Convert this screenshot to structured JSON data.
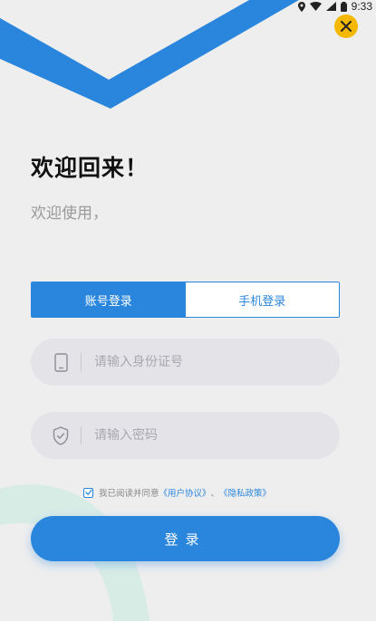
{
  "status": {
    "time": "9:33"
  },
  "colors": {
    "accent": "#2a86dc",
    "close": "#f5b800",
    "decoration": "#d8ece6"
  },
  "header": {
    "title": "欢迎回来！",
    "subtitle": "欢迎使用，"
  },
  "tabs": [
    {
      "label": "账号登录",
      "active": true
    },
    {
      "label": "手机登录",
      "active": false
    }
  ],
  "form": {
    "id_field": {
      "placeholder": "请输入身份证号",
      "value": "",
      "icon": "phone-icon"
    },
    "password_field": {
      "placeholder": "请输入密码",
      "value": "",
      "icon": "shield-check-icon"
    }
  },
  "agreement": {
    "checked": true,
    "prefix": "我已阅读并同意",
    "link1": "《用户协议》",
    "separator": "、",
    "link2": "《隐私政策》"
  },
  "login_button": {
    "label": "登录"
  }
}
